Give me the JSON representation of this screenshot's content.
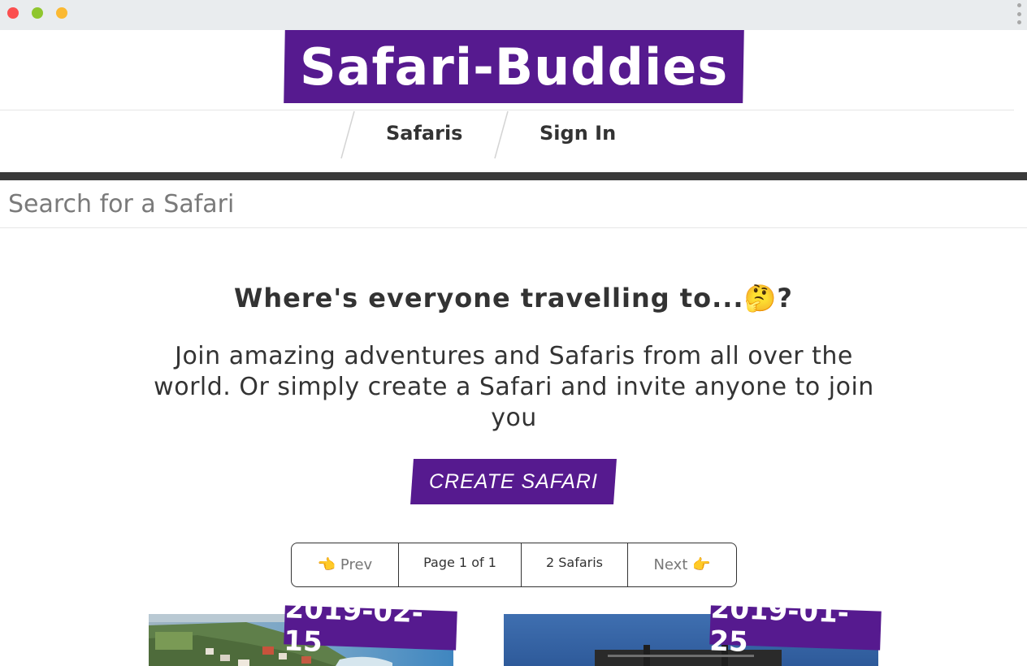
{
  "window": {
    "controls": [
      "close",
      "minimize",
      "maximize"
    ],
    "menu_icon": "kebab-menu-icon"
  },
  "brand": {
    "name": "Safari-Buddies",
    "color": "#561a8f"
  },
  "nav": {
    "items": [
      {
        "label": "Safaris"
      },
      {
        "label": "Sign In"
      }
    ]
  },
  "search": {
    "placeholder": "Search for a Safari",
    "value": ""
  },
  "hero": {
    "title": "Where's everyone travelling to...",
    "title_emoji": "🤔",
    "title_suffix": "?",
    "text": "Join amazing adventures and Safaris from all over the world. Or simply create a Safari and invite anyone to join you",
    "cta_label": "CREATE SAFARI"
  },
  "pagination": {
    "prev_label": "👈 Prev",
    "page_label": "Page 1 of 1",
    "count_label": "2 Safaris",
    "next_label": "Next 👉"
  },
  "safaris": [
    {
      "date": "2019-02-15",
      "image": "coastal-town-photo"
    },
    {
      "date": "2019-01-25",
      "image": "mount-kilimanjaro-sign-photo"
    }
  ]
}
